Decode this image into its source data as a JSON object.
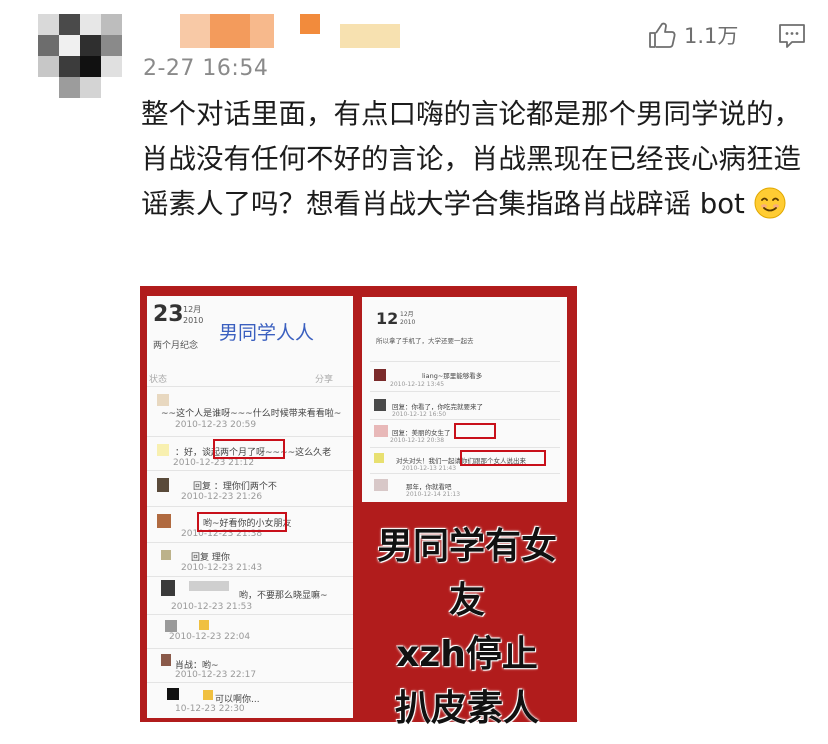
{
  "post": {
    "timestamp": "2-27 16:54",
    "like_count": "1.1万",
    "content_text": "整个对话里面，有点口嗨的言论都是那个男同学说的，肖战没有任何不好的言论，肖战黑现在已经丧心病狂造谣素人了吗？想看肖战大学合集指路肖战辟谣 bot"
  },
  "image": {
    "left": {
      "day": "23",
      "month": "12月",
      "year": "2010",
      "title": "男同学人人",
      "subtitle": "两个月纪念",
      "status": "状态",
      "share": "分享",
      "rows": [
        {
          "text": "~~这个人是谁呀~~~什么时候带来看看啦~",
          "date": "2010-12-23 20:59"
        },
        {
          "text": "：好，谈起两个月了呀~~~~这么久老",
          "date": "2010-12-23 21:12"
        },
        {
          "text": "回复      ：理你们两个不",
          "date": "2010-12-23 21:26"
        },
        {
          "text": "哟~好看你的小女朋友",
          "date": "2010-12-23 21:38"
        },
        {
          "text": "回复        理你",
          "date": "2010-12-23 21:43"
        },
        {
          "text": "哟，不要那么晓显嘛~",
          "date": "2010-12-23 21:53"
        },
        {
          "text": "",
          "date": "2010-12-23 22:04"
        },
        {
          "text": "肖战：哟~",
          "date": "2010-12-23 22:17"
        },
        {
          "text": "可以啊你...",
          "date": "10-12-23 22:30"
        }
      ]
    },
    "right": {
      "day": "12",
      "month": "12月",
      "year": "2010",
      "caption": "所以拿了手机了，大学还要一起去",
      "rows": [
        {
          "text": "liang~那里能够看多",
          "date": "2010-12-12 13:45"
        },
        {
          "text": "回复：你看了，你吃完就要来了",
          "date": "2010-12-12 16:50"
        },
        {
          "text": "回复：美丽的女生了",
          "date": "2010-12-12 20:38"
        },
        {
          "text": "对头对头！我们一起请你们跟那个女人说出来",
          "date": "2010-12-13 21:43"
        },
        {
          "text": "那年，你就看吧",
          "date": "2010-12-14 21:13"
        }
      ]
    },
    "overlay_lines": [
      "男同学有女友",
      "xzh停止",
      "扒皮素人"
    ]
  }
}
